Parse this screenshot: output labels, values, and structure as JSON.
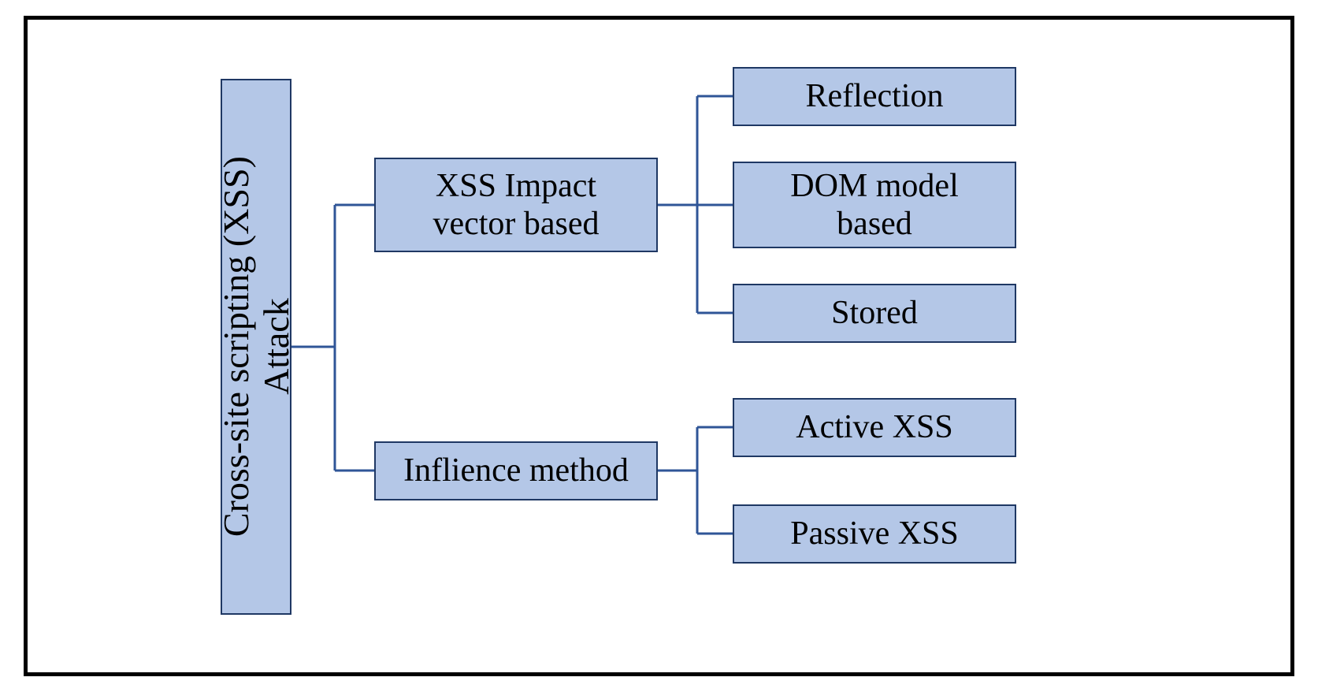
{
  "diagram": {
    "root": {
      "line1": "Cross-site scripting (XSS)",
      "line2": "Attack"
    },
    "categories": [
      {
        "label_line1": "XSS Impact",
        "label_line2": "vector based",
        "children": [
          {
            "label": "Reflection"
          },
          {
            "label_line1": "DOM model",
            "label_line2": "based"
          },
          {
            "label": "Stored"
          }
        ]
      },
      {
        "label": "Inflience method",
        "children": [
          {
            "label": "Active XSS"
          },
          {
            "label": "Passive XSS"
          }
        ]
      }
    ]
  }
}
